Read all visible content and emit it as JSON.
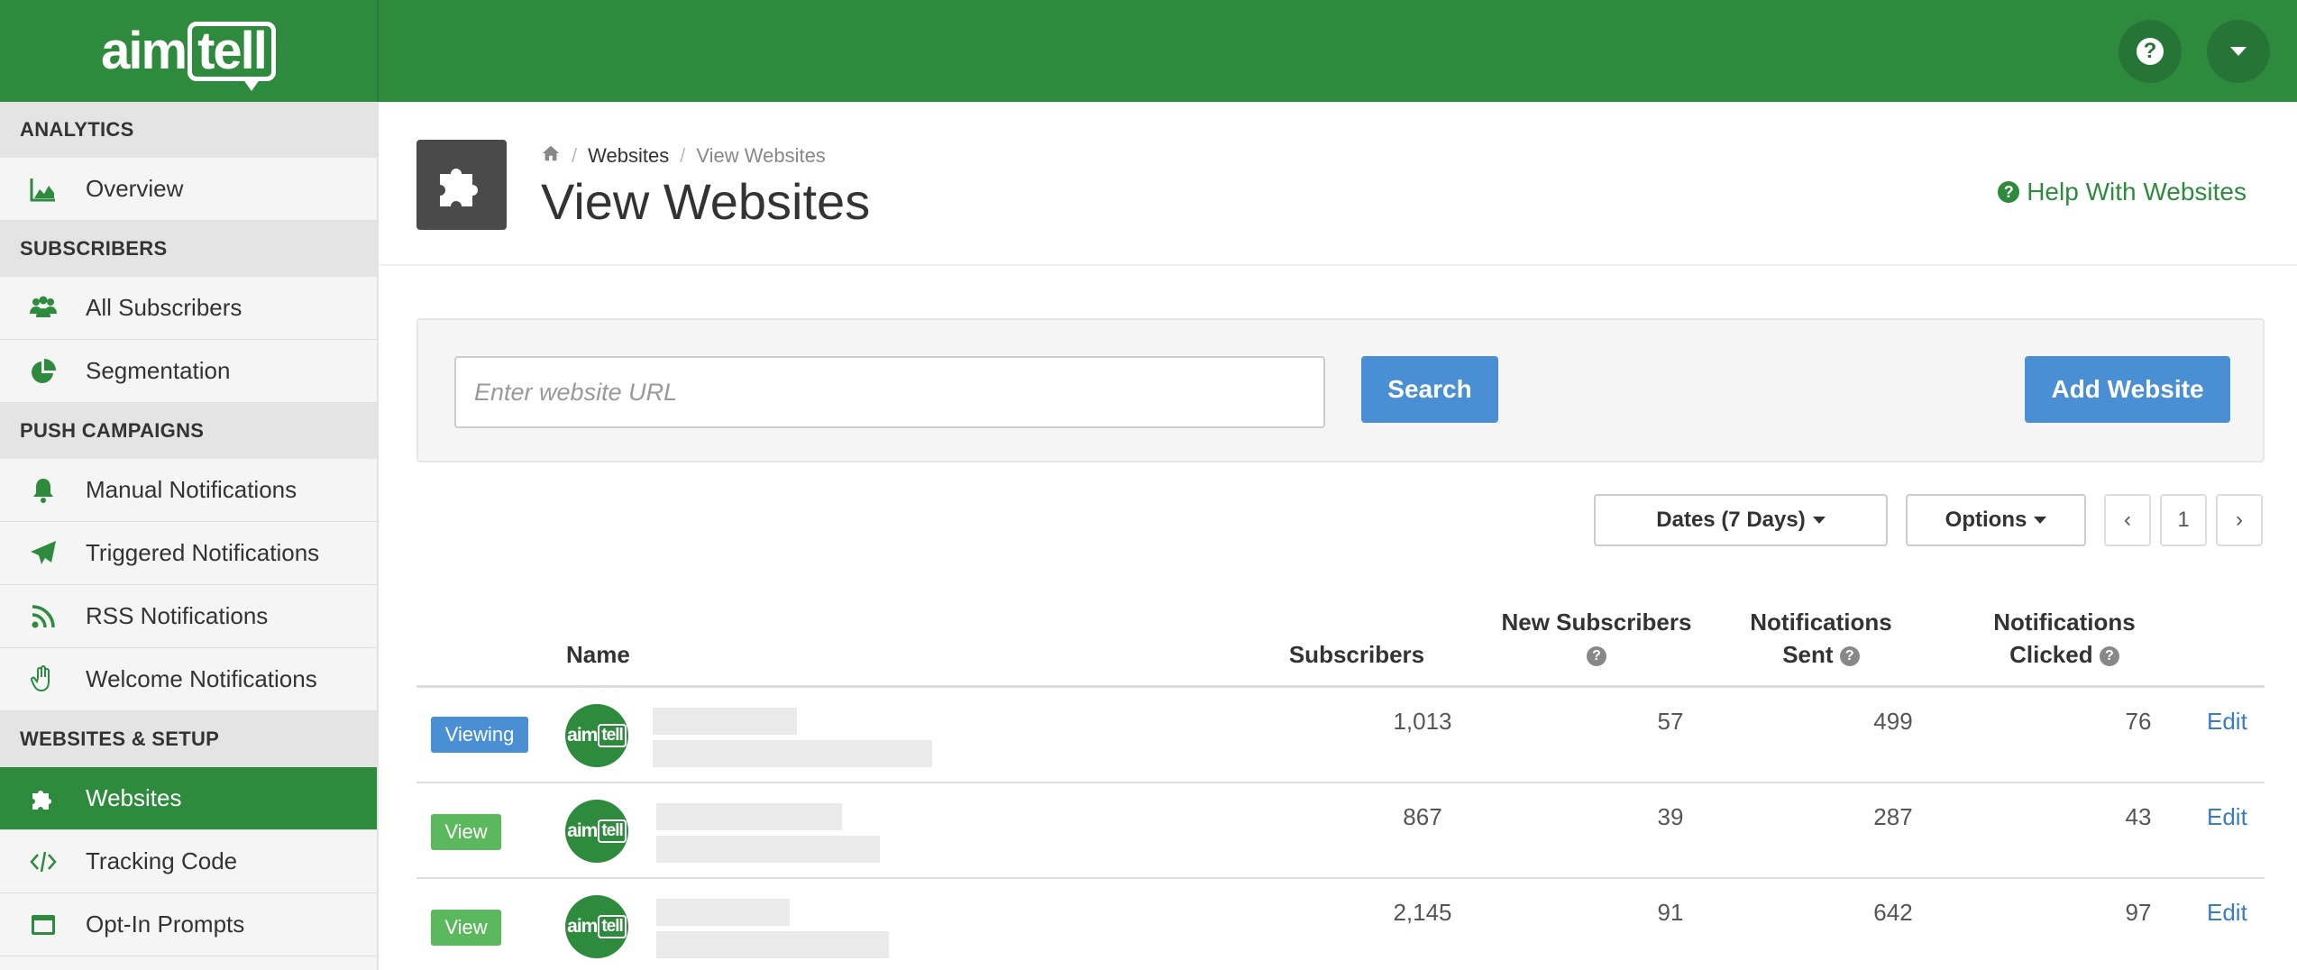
{
  "header": {
    "logo_main": "aim",
    "logo_bubble": "tell",
    "help_icon_glyph": "?",
    "help_icon": "question-circle-icon",
    "dropdown_icon": "caret-down-icon"
  },
  "sidebar": {
    "sections": [
      {
        "title": "ANALYTICS",
        "items": [
          {
            "label": "Overview",
            "icon": "area-chart-icon"
          }
        ]
      },
      {
        "title": "SUBSCRIBERS",
        "items": [
          {
            "label": "All Subscribers",
            "icon": "users-icon"
          },
          {
            "label": "Segmentation",
            "icon": "pie-chart-icon"
          }
        ]
      },
      {
        "title": "PUSH CAMPAIGNS",
        "items": [
          {
            "label": "Manual Notifications",
            "icon": "bell-icon"
          },
          {
            "label": "Triggered Notifications",
            "icon": "paper-plane-icon"
          },
          {
            "label": "RSS Notifications",
            "icon": "rss-icon"
          },
          {
            "label": "Welcome Notifications",
            "icon": "hand-wave-icon"
          }
        ]
      },
      {
        "title": "WEBSITES & SETUP",
        "items": [
          {
            "label": "Websites",
            "icon": "puzzle-icon",
            "active": true
          },
          {
            "label": "Tracking Code",
            "icon": "code-icon"
          },
          {
            "label": "Opt-In Prompts",
            "icon": "window-icon"
          }
        ]
      }
    ]
  },
  "page": {
    "breadcrumb": {
      "home_icon": "home-icon",
      "parent": "Websites",
      "current": "View Websites"
    },
    "title": "View Websites",
    "help_link": "Help With Websites",
    "page_icon": "puzzle-icon"
  },
  "search": {
    "placeholder": "Enter website URL",
    "value": "",
    "search_button": "Search",
    "add_button": "Add Website"
  },
  "controls": {
    "dates": "Dates (7 Days)",
    "options": "Options",
    "prev": "‹",
    "page": "1",
    "next": "›"
  },
  "table": {
    "headers": {
      "name": "Name",
      "subscribers": "Subscribers",
      "new_subscribers": "New Subscribers",
      "notifications_sent_1": "Notifications",
      "notifications_sent_2": "Sent",
      "notifications_clicked_1": "Notifications",
      "notifications_clicked_2": "Clicked",
      "q": "?"
    },
    "rows": [
      {
        "status": "Viewing",
        "avatar_main": "aim",
        "avatar_bubble": "tell",
        "subscribers": "1,013",
        "new_subscribers": "57",
        "sent": "499",
        "clicked": "76",
        "edit": "Edit"
      },
      {
        "status": "View",
        "avatar_main": "aim",
        "avatar_bubble": "tell",
        "subscribers": "867",
        "new_subscribers": "39",
        "sent": "287",
        "clicked": "43",
        "edit": "Edit"
      },
      {
        "status": "View",
        "avatar_main": "aim",
        "avatar_bubble": "tell",
        "subscribers": "2,145",
        "new_subscribers": "91",
        "sent": "642",
        "clicked": "97",
        "edit": "Edit"
      }
    ]
  },
  "colors": {
    "brand_green": "#2e8b3e",
    "primary_blue": "#4a8ed4",
    "success_green": "#5cb85c",
    "link_blue": "#3a7cc0"
  }
}
